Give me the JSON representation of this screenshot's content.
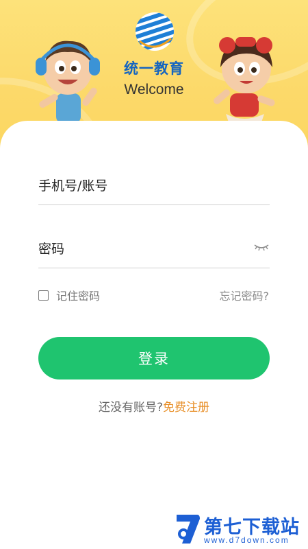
{
  "header": {
    "brand_name": "统一教育",
    "welcome": "Welcome"
  },
  "form": {
    "phone_placeholder": "手机号/账号",
    "password_placeholder": "密码",
    "remember_label": "记住密码",
    "forgot_label": "忘记密码?",
    "login_label": "登录",
    "no_account_text": "还没有账号?",
    "register_label": "免费注册"
  },
  "watermark": {
    "title": "第七下载站",
    "url": "www.d7down.com"
  },
  "icons": {
    "logo": "striped-globe-icon",
    "password_visibility": "closed-eye-icon",
    "remember": "checkbox-icon"
  },
  "colors": {
    "header_bg": "#fcd96a",
    "brand_blue": "#1565c0",
    "primary_green": "#1fc46f",
    "register_orange": "#e8902a"
  }
}
